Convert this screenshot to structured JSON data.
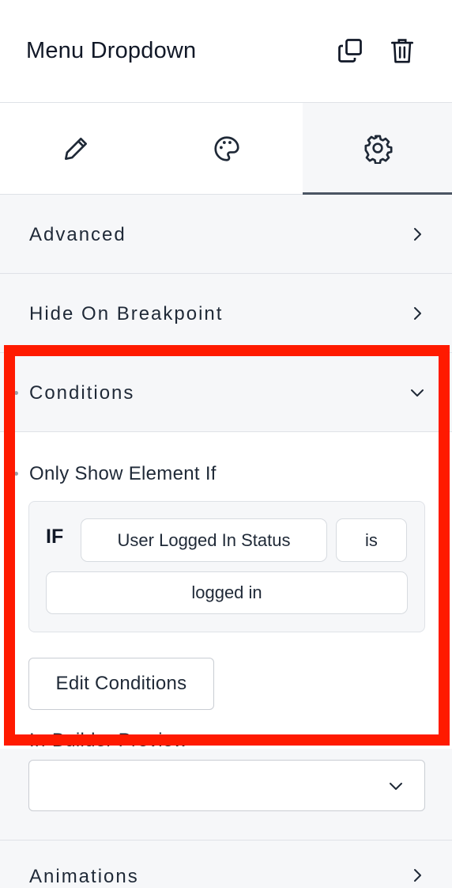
{
  "panel": {
    "title": "Menu Dropdown"
  },
  "header_actions": [
    {
      "name": "copy",
      "icon": "copy-icon"
    },
    {
      "name": "delete",
      "icon": "trash-icon"
    }
  ],
  "tabs": [
    {
      "name": "edit",
      "icon": "pencil-icon",
      "active": false
    },
    {
      "name": "style",
      "icon": "palette-icon",
      "active": false
    },
    {
      "name": "settings",
      "icon": "gear-icon",
      "active": true
    }
  ],
  "sections": {
    "advanced": {
      "label": "Advanced",
      "expanded": false
    },
    "hide_on_breakpoint": {
      "label": "Hide On Breakpoint",
      "expanded": false
    },
    "conditions": {
      "label": "Conditions",
      "expanded": true
    },
    "animations": {
      "label": "Animations",
      "expanded": false
    }
  },
  "conditions": {
    "heading": "Only Show Element If",
    "if_label": "IF",
    "rule": {
      "field": "User Logged In Status",
      "operator": "is",
      "value": "logged in"
    },
    "edit_button": "Edit Conditions"
  },
  "in_builder_preview": {
    "label": "In-Builder Preview",
    "selected": ""
  },
  "colors": {
    "highlight": "#ff1a00",
    "background": "#f6f7f9",
    "active_tab_border": "#4b5563"
  }
}
